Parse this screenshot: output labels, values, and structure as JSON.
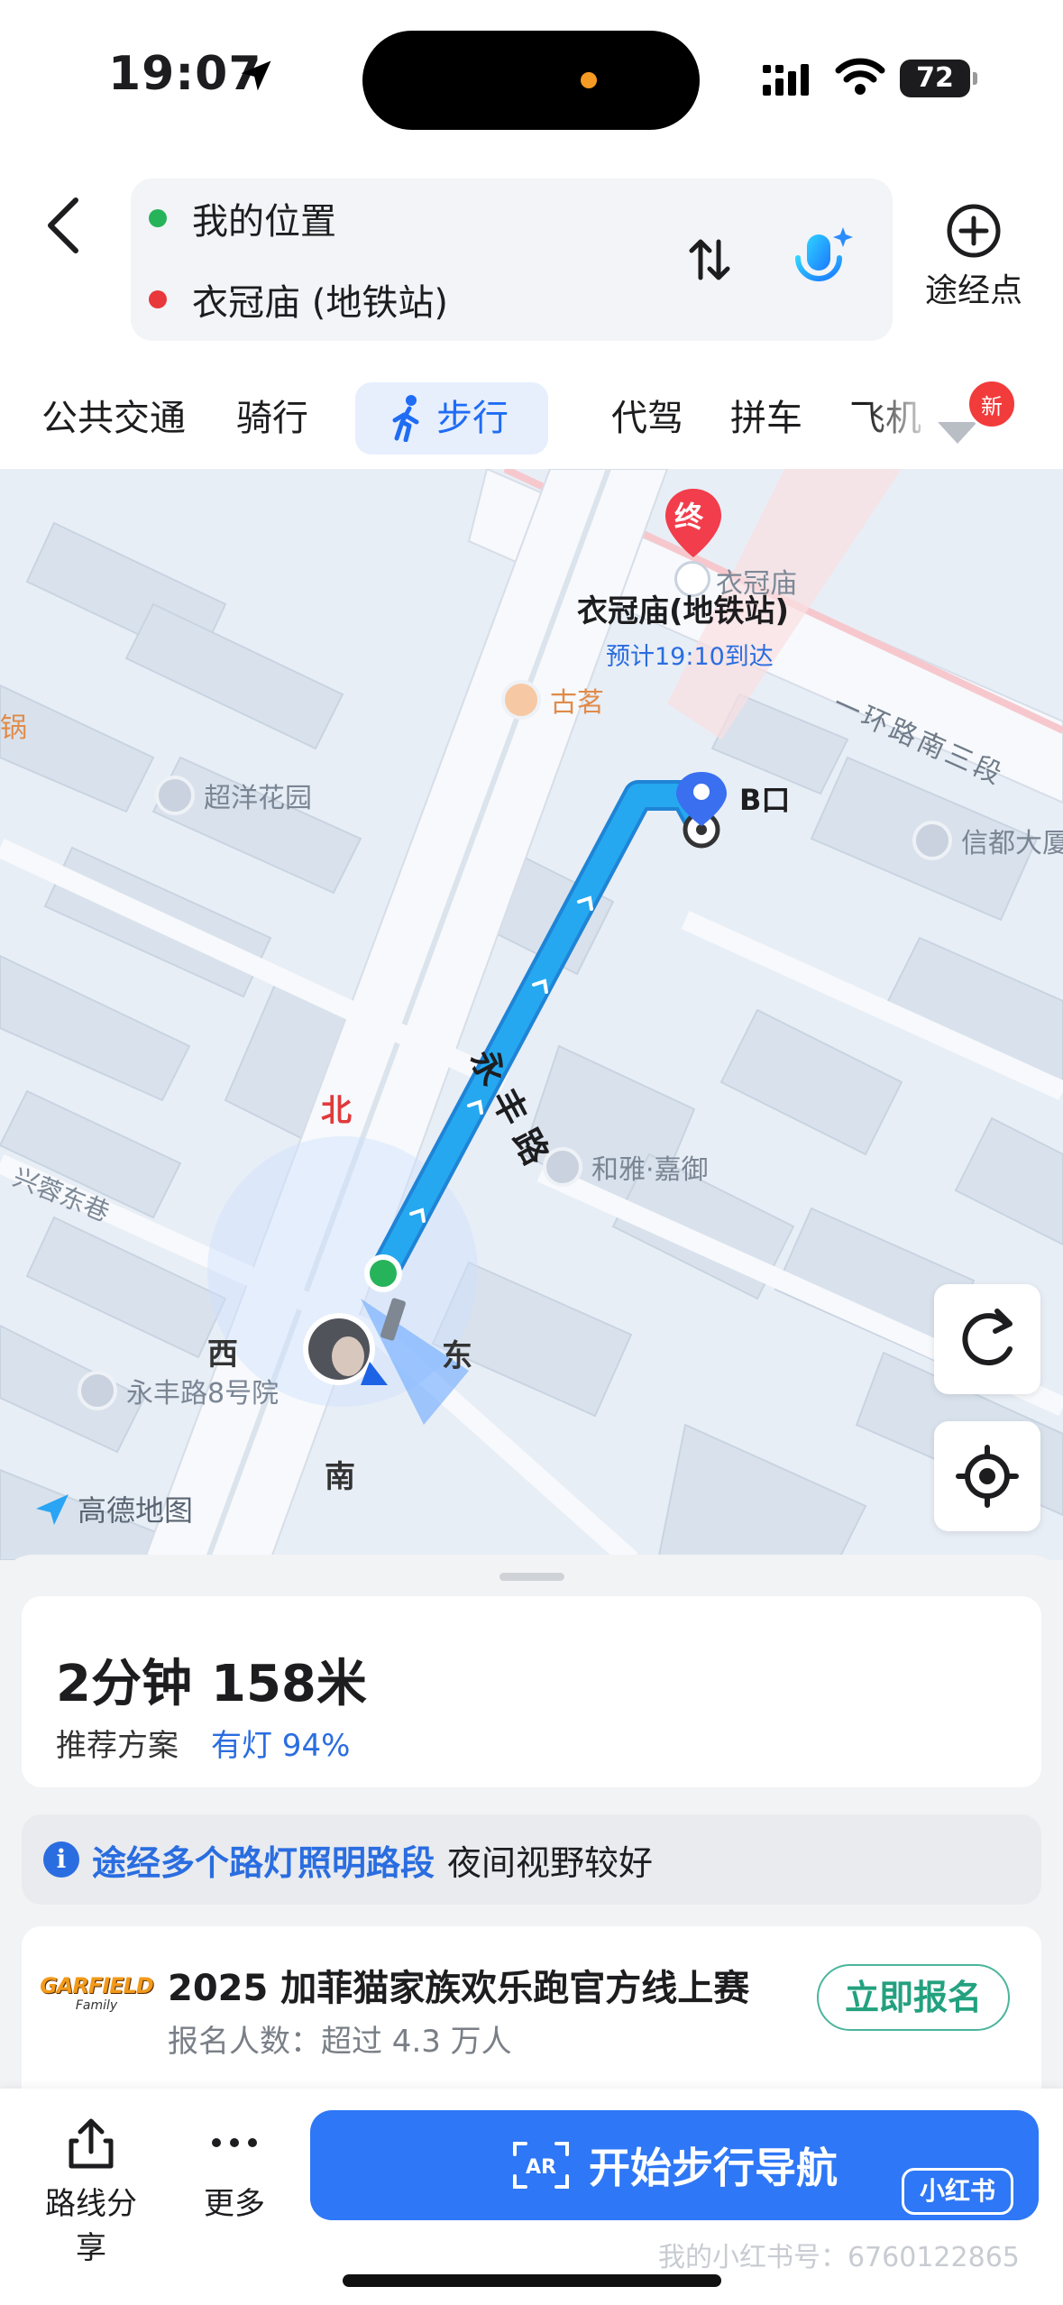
{
  "status_bar": {
    "time": "19:07",
    "battery": "72"
  },
  "route": {
    "origin": "我的位置",
    "destination": "衣冠庙 (地铁站)",
    "via_label": "途经点",
    "colors": {
      "origin_dot": "#27b35a",
      "destination_dot": "#e8383b"
    }
  },
  "modes": [
    {
      "label": "公共交通",
      "active": false
    },
    {
      "label": "骑行",
      "active": false
    },
    {
      "label": "步行",
      "active": true
    },
    {
      "label": "代驾",
      "active": false
    },
    {
      "label": "拼车",
      "active": false
    },
    {
      "label": "飞机",
      "active": false
    }
  ],
  "badge_new": "新",
  "map": {
    "destination_pin": "终",
    "destination_station_label": "衣冠庙",
    "destination_title": "衣冠庙(地铁站)",
    "eta": "预计19:10到达",
    "exit_label": "B口",
    "road_name": "永丰路",
    "road_labels": [
      "一环路南三段",
      "兴蓉东巷"
    ],
    "partial_label": "锅",
    "pois": [
      "古茗",
      "超洋花园",
      "信都大厦",
      "和雅·嘉御",
      "永丰路8号院"
    ],
    "compass": {
      "north": "北",
      "west": "西",
      "east": "东",
      "south": "南"
    },
    "logo": "高德地图",
    "route_color": "#25a8f0"
  },
  "summary": {
    "duration": "2分钟",
    "distance": "158米",
    "plan": "推荐方案",
    "lights": "有灯 94%"
  },
  "info_banner": {
    "icon": "i",
    "highlight": "途经多个路灯照明路段",
    "text": "夜间视野较好"
  },
  "promo": {
    "logo_text": "GARFIELD",
    "logo_sub": "Family",
    "title": "2025 加菲猫家族欢乐跑官方线上赛",
    "subtitle": "报名人数：超过 4.3 万人",
    "button": "立即报名"
  },
  "bottom_bar": {
    "share_label": "路线分享",
    "more_label": "更多",
    "start_label": "开始步行导航",
    "ar_label": "AR",
    "xhs_label": "小红书",
    "watermark": "我的小红书号：6760122865"
  }
}
